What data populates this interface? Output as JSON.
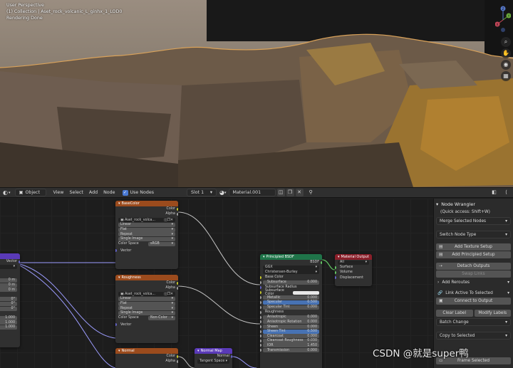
{
  "viewport": {
    "line1": "User Perspective",
    "line2": "(1) Collection | Aset_rock_volcanic_L_ginhx_1_LOD0",
    "line3": "Rendering Done",
    "gizmo": {
      "z": "Z",
      "y": "Y",
      "x": "X"
    },
    "tools": [
      "zoom-icon",
      "hand-icon",
      "camera-icon",
      "grid-icon"
    ]
  },
  "header": {
    "editor_type_icon": "node-editor-icon",
    "mode": "Object",
    "menus": [
      "View",
      "Select",
      "Add",
      "Node"
    ],
    "use_nodes_label": "Use Nodes",
    "slot": "Slot 1",
    "material": "Material.001"
  },
  "nodes": {
    "basecolor": {
      "title": "BaseColor",
      "outputs": [
        "Color",
        "Alpha"
      ],
      "image": "Aset_rock_volca...",
      "options": [
        "Linear",
        "Flat",
        "Repeat",
        "Single Image"
      ],
      "colorspace_label": "Color Space",
      "colorspace_value": "sRGB",
      "vector": "Vector"
    },
    "roughness": {
      "title": "Roughness",
      "outputs": [
        "Color",
        "Alpha"
      ],
      "image": "Aset_rock_volca...",
      "options": [
        "Linear",
        "Flat",
        "Repeat",
        "Single Image"
      ],
      "colorspace_label": "Color Space",
      "colorspace_value": "Non-Color",
      "vector": "Vector"
    },
    "normal": {
      "title": "Normal",
      "outputs": [
        "Color",
        "Alpha"
      ]
    },
    "normal_map": {
      "title": "Normal Map",
      "output": "Normal",
      "space": "Tangent Space"
    },
    "principled": {
      "title": "Principled BSDF",
      "output": "BSDF",
      "distribution": "GGX",
      "subsurface_method": "Christensen-Burley",
      "inputs": [
        {
          "label": "Base Color",
          "style": "plain"
        },
        {
          "label": "Subsurface",
          "value": "0.000",
          "style": "field"
        },
        {
          "label": "Subsurface Radius",
          "style": "plain"
        },
        {
          "label": "Subsurface Color",
          "style": "white"
        },
        {
          "label": "Metallic",
          "value": "0.000",
          "style": "field"
        },
        {
          "label": "Specular",
          "value": "0.500",
          "style": "blue"
        },
        {
          "label": "Specular Tint",
          "value": "0.000",
          "style": "field"
        },
        {
          "label": "Roughness",
          "style": "plain"
        },
        {
          "label": "Anisotropic",
          "value": "0.000",
          "style": "field"
        },
        {
          "label": "Anisotropic Rotation",
          "value": "0.000",
          "style": "field"
        },
        {
          "label": "Sheen",
          "value": "0.000",
          "style": "field"
        },
        {
          "label": "Sheen Tint",
          "value": "0.500",
          "style": "blue"
        },
        {
          "label": "Clearcoat",
          "value": "0.000",
          "style": "field"
        },
        {
          "label": "Clearcoat Roughness",
          "value": "0.030",
          "style": "field"
        },
        {
          "label": "IOR",
          "value": "1.450",
          "style": "field"
        },
        {
          "label": "Transmission",
          "value": "0.000",
          "style": "field"
        }
      ]
    },
    "material_output": {
      "title": "Material Output",
      "target": "All",
      "inputs": [
        "Surface",
        "Volume",
        "Displacement"
      ]
    },
    "left_stub": {
      "output": "Vector",
      "values": [
        "0 m",
        "0 m",
        "0 m",
        "0°",
        "0°",
        "0°",
        "1.000",
        "1.000",
        "1.000"
      ]
    }
  },
  "sidebar": {
    "title": "Node Wrangler",
    "quick_access": "(Quick access: Shift+W)",
    "merge_selected": "Merge Selected Nodes",
    "switch_node_type": "Switch Node Type",
    "add_texture_setup": "Add Texture Setup",
    "add_principled_setup": "Add Principled Setup",
    "detach_outputs": "Detach Outputs",
    "swap_links": "Swap Links",
    "add_reroutes": "Add Reroutes",
    "link_active_to_selected": "Link Active To Selected",
    "connect_to_output": "Connect to Output",
    "clear_label": "Clear Label",
    "modify_labels": "Modify Labels",
    "batch_change": "Batch Change",
    "copy_to_selected": "Copy to Selected",
    "frame_selected": "Frame Selected"
  },
  "watermark": "CSDN @就是super鸭"
}
